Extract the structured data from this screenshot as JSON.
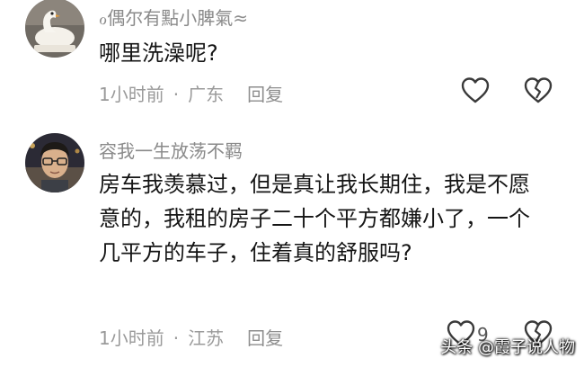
{
  "comments": [
    {
      "username": "ℴ偶尔有點小脾氣≈",
      "text": "哪里洗澡呢?",
      "time": "1小时前",
      "separator": "·",
      "location": "广东",
      "reply_label": "回复",
      "like_count": "",
      "avatar_icon": "swan-avatar"
    },
    {
      "username": "容我一生放荡不羁",
      "text": "房车我羡慕过，但是真让我长期住，我是不愿意的，我租的房子二十个平方都嫌小了，一个几平方的车子，住着真的舒服吗?",
      "time": "1小时前",
      "separator": "·",
      "location": "江苏",
      "reply_label": "回复",
      "like_count": "9",
      "avatar_icon": "man-with-glasses-avatar"
    }
  ],
  "icons": {
    "like": "heart-outline-icon",
    "dislike": "broken-heart-icon"
  },
  "watermark": "头条 @霞子说人物",
  "colors": {
    "background": "#ffffff",
    "username": "#8a8a8a",
    "meta": "#9a9a9a",
    "text": "#151515"
  }
}
